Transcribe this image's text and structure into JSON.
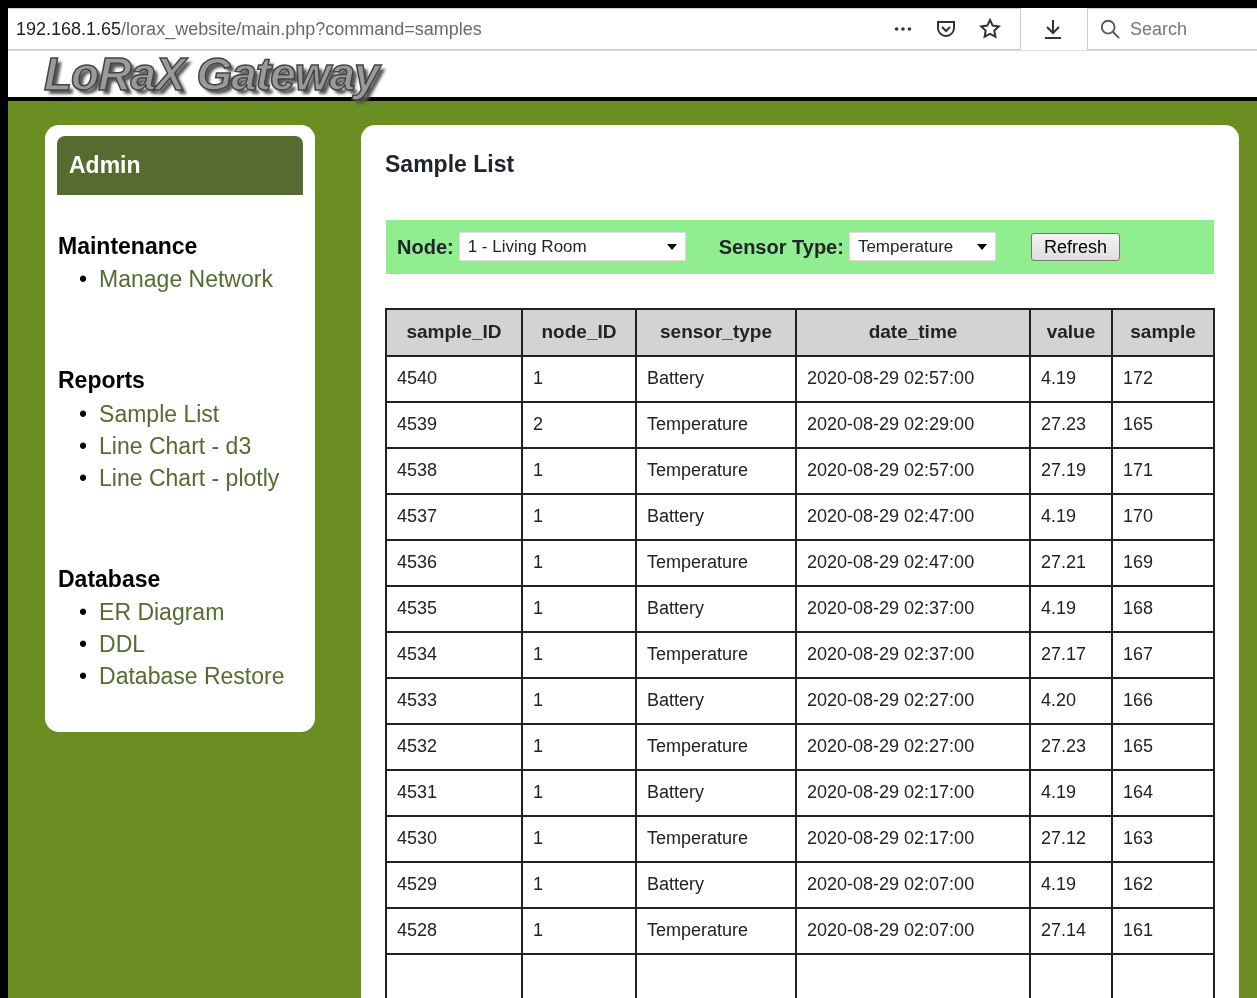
{
  "browser": {
    "url_host": "192.168.1.65",
    "url_path": "/lorax_website/main.php?command=samples",
    "search": {
      "placeholder": "Search"
    }
  },
  "header": {
    "logo": "LoRaX Gateway"
  },
  "sidebar": {
    "title": "Admin",
    "sections": [
      {
        "heading": "Maintenance",
        "links": [
          {
            "bullet": "•",
            "label": "Manage Network"
          }
        ]
      },
      {
        "heading": "Reports",
        "links": [
          {
            "bullet": "•",
            "label": "Sample List"
          },
          {
            "bullet": "•",
            "label": "Line Chart - d3"
          },
          {
            "bullet": "•",
            "label": "Line Chart - plotly"
          }
        ]
      },
      {
        "heading": "Database",
        "links": [
          {
            "bullet": "•",
            "label": "ER Diagram"
          },
          {
            "bullet": "•",
            "label": "DDL"
          },
          {
            "bullet": "•",
            "label": "Database Restore"
          }
        ]
      }
    ]
  },
  "main": {
    "title": "Sample List",
    "filters": {
      "node_label": "Node:",
      "node_value": "1 - Living Room",
      "sensor_label": "Sensor Type:",
      "sensor_value": "Temperature",
      "refresh": "Refresh"
    },
    "table": {
      "columns": [
        "sample_ID",
        "node_ID",
        "sensor_type",
        "date_time",
        "value",
        "sample"
      ],
      "rows": [
        [
          "4540",
          "1",
          "Battery",
          "2020-08-29 02:57:00",
          "4.19",
          "172"
        ],
        [
          "4539",
          "2",
          "Temperature",
          "2020-08-29 02:29:00",
          "27.23",
          "165"
        ],
        [
          "4538",
          "1",
          "Temperature",
          "2020-08-29 02:57:00",
          "27.19",
          "171"
        ],
        [
          "4537",
          "1",
          "Battery",
          "2020-08-29 02:47:00",
          "4.19",
          "170"
        ],
        [
          "4536",
          "1",
          "Temperature",
          "2020-08-29 02:47:00",
          "27.21",
          "169"
        ],
        [
          "4535",
          "1",
          "Battery",
          "2020-08-29 02:37:00",
          "4.19",
          "168"
        ],
        [
          "4534",
          "1",
          "Temperature",
          "2020-08-29 02:37:00",
          "27.17",
          "167"
        ],
        [
          "4533",
          "1",
          "Battery",
          "2020-08-29 02:27:00",
          "4.20",
          "166"
        ],
        [
          "4532",
          "1",
          "Temperature",
          "2020-08-29 02:27:00",
          "27.23",
          "165"
        ],
        [
          "4531",
          "1",
          "Battery",
          "2020-08-29 02:17:00",
          "4.19",
          "164"
        ],
        [
          "4530",
          "1",
          "Temperature",
          "2020-08-29 02:17:00",
          "27.12",
          "163"
        ],
        [
          "4529",
          "1",
          "Battery",
          "2020-08-29 02:07:00",
          "4.19",
          "162"
        ],
        [
          "4528",
          "1",
          "Temperature",
          "2020-08-29 02:07:00",
          "27.14",
          "161"
        ]
      ]
    }
  }
}
